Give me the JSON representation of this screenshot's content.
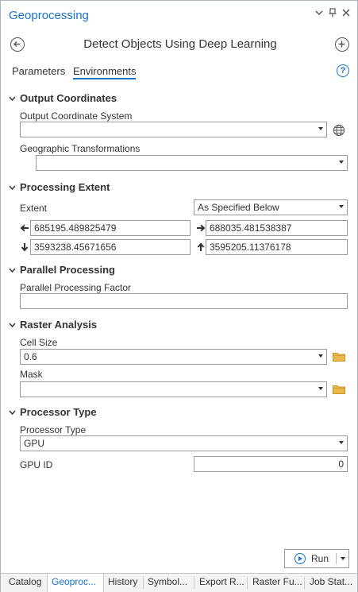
{
  "window": {
    "title": "Geoprocessing",
    "controls": {
      "menu_icon": "dropdown-arrow-icon",
      "pin_icon": "pin-icon",
      "close_icon": "close-icon"
    }
  },
  "tool": {
    "title": "Detect Objects Using Deep Learning",
    "back_icon": "back-arrow-icon",
    "add_icon": "add-icon"
  },
  "tabs": [
    {
      "label": "Parameters",
      "active": false
    },
    {
      "label": "Environments",
      "active": true
    }
  ],
  "help_icon": "help-icon",
  "sections": {
    "output_coordinates": {
      "title": "Output Coordinates",
      "output_coordinate_system": {
        "label": "Output Coordinate System",
        "value": ""
      },
      "geographic_transformations": {
        "label": "Geographic Transformations",
        "value": ""
      }
    },
    "processing_extent": {
      "title": "Processing Extent",
      "extent": {
        "label": "Extent",
        "value": "As Specified Below"
      },
      "left": "685195.489825479",
      "right": "688035.481538387",
      "bottom": "3593238.45671656",
      "top": "3595205.11376178"
    },
    "parallel_processing": {
      "title": "Parallel Processing",
      "factor": {
        "label": "Parallel Processing Factor",
        "value": ""
      }
    },
    "raster_analysis": {
      "title": "Raster Analysis",
      "cell_size": {
        "label": "Cell Size",
        "value": "0.6"
      },
      "mask": {
        "label": "Mask",
        "value": ""
      }
    },
    "processor_type": {
      "title": "Processor Type",
      "processor": {
        "label": "Processor Type",
        "value": "GPU"
      },
      "gpu_id": {
        "label": "GPU ID",
        "value": "0"
      }
    }
  },
  "run": {
    "label": "Run"
  },
  "bottom_tabs": [
    {
      "label": "Catalog",
      "active": false
    },
    {
      "label": "Geoproc...",
      "active": true
    },
    {
      "label": "History",
      "active": false
    },
    {
      "label": "Symbol...",
      "active": false
    },
    {
      "label": "Export R...",
      "active": false
    },
    {
      "label": "Raster Fu...",
      "active": false
    },
    {
      "label": "Job Stat...",
      "active": false
    }
  ],
  "colors": {
    "accent": "#1a73c8",
    "folder": "#e8b84a",
    "text": "#333333",
    "border": "#9a9a9a"
  }
}
